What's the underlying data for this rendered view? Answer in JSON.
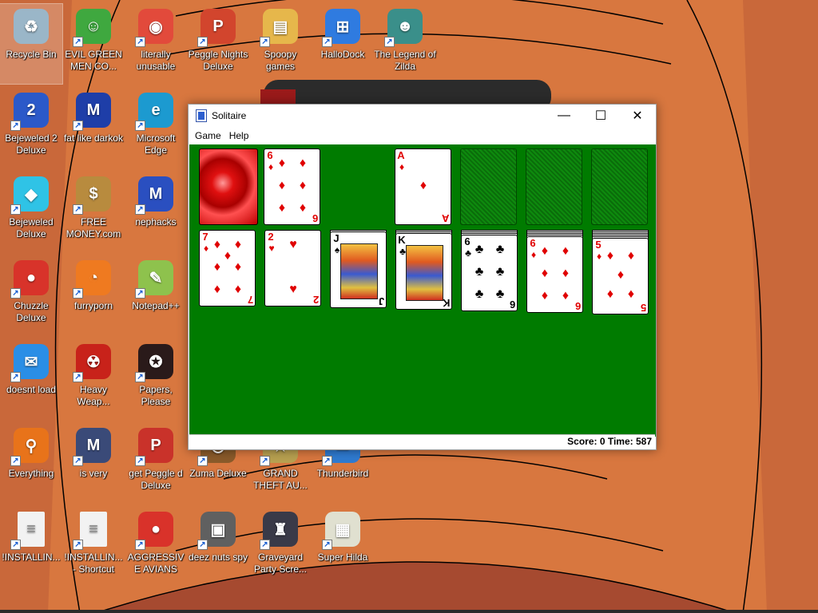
{
  "desktop": {
    "icons": [
      {
        "label": "Recycle Bin",
        "icon": "recycle-bin-icon",
        "color": "#9ab6c8",
        "glyph": "♻"
      },
      {
        "label": "EVIL GREEN MEN CO...",
        "icon": "green-men-icon",
        "color": "#3fa83f",
        "glyph": "☺"
      },
      {
        "label": "literally unusable",
        "icon": "chrome-icon",
        "color": "#e24a3b",
        "glyph": "◉"
      },
      {
        "label": "Peggle Nights Deluxe",
        "icon": "peggle-icon",
        "color": "#d2452d",
        "glyph": "P"
      },
      {
        "label": "Spoopy games",
        "icon": "folder-icon",
        "color": "#e6b74b",
        "glyph": "▤"
      },
      {
        "label": "HalloDock",
        "icon": "windows-logo-icon",
        "color": "#2f7be0",
        "glyph": "⊞"
      },
      {
        "label": "The Legend of Zilda",
        "icon": "zilda-icon",
        "color": "#3a8f8a",
        "glyph": "☻"
      },
      {
        "label": "Bejeweled 2 Deluxe",
        "icon": "bejeweled2-icon",
        "color": "#2b59c9",
        "glyph": "2"
      },
      {
        "label": "fat like darkok",
        "icon": "mpi-icon",
        "color": "#1e3ea8",
        "glyph": "M"
      },
      {
        "label": "Microsoft Edge",
        "icon": "edge-icon",
        "color": "#1c9ad0",
        "glyph": "e"
      },
      {
        "label": "Bejeweled Deluxe",
        "icon": "gem-icon",
        "color": "#2fc3e6",
        "glyph": "◆"
      },
      {
        "label": "FREE MONEY.com",
        "icon": "money-bag-icon",
        "color": "#b88b3e",
        "glyph": "$"
      },
      {
        "label": "nephacks",
        "icon": "mpi-icon",
        "color": "#2a4fc0",
        "glyph": "M"
      },
      {
        "label": "Chuzzle Deluxe",
        "icon": "chuzzle-icon",
        "color": "#d8332a",
        "glyph": "●"
      },
      {
        "label": "furryporn",
        "icon": "firefox-icon",
        "color": "#ef7a20",
        "glyph": "◔"
      },
      {
        "label": "Notepad++",
        "icon": "notepadpp-icon",
        "color": "#8ec24d",
        "glyph": "✎"
      },
      {
        "label": "doesnt load",
        "icon": "thunderbird-icon",
        "color": "#2a8ee6",
        "glyph": "✉"
      },
      {
        "label": "Heavy Weap...",
        "icon": "radiation-icon",
        "color": "#c8221a",
        "glyph": "☢"
      },
      {
        "label": "Papers, Please",
        "icon": "papers-please-icon",
        "color": "#2a1a1a",
        "glyph": "✪"
      },
      {
        "label": "Everything",
        "icon": "search-icon",
        "color": "#e8731a",
        "glyph": "⚲"
      },
      {
        "label": "is very",
        "icon": "mpi-icon",
        "color": "#3a4a78",
        "glyph": "M"
      },
      {
        "label": "get Peggle d Deluxe",
        "icon": "peggle-icon",
        "color": "#c9322a",
        "glyph": "P"
      },
      {
        "label": "Zuma Deluxe",
        "icon": "zuma-icon",
        "color": "#8a5a2a",
        "glyph": "◎"
      },
      {
        "label": "GRAND THEFT AU...",
        "icon": "gta-icon",
        "color": "#b8a050",
        "glyph": "★"
      },
      {
        "label": "Thunderbird",
        "icon": "thunderbird-icon",
        "color": "#2f7ad0",
        "glyph": "✉"
      },
      {
        "label": "!INSTALLIN...",
        "icon": "document-icon",
        "color": "#f2f2f2",
        "glyph": "≡"
      },
      {
        "label": "!INSTALLIN... - Shortcut",
        "icon": "document-icon",
        "color": "#f2f2f2",
        "glyph": "≡"
      },
      {
        "label": "AGGRESSIVE AVIANS",
        "icon": "angry-bird-icon",
        "color": "#d9322a",
        "glyph": "●"
      },
      {
        "label": "deez nuts spy",
        "icon": "stacked-windows-icon",
        "color": "#606060",
        "glyph": "▣"
      },
      {
        "label": "Graveyard Party Scre...",
        "icon": "graveyard-icon",
        "color": "#3a3a48",
        "glyph": "♜"
      },
      {
        "label": "Super Hilda",
        "icon": "hilda-icon",
        "color": "#e0e0d0",
        "glyph": "▦"
      }
    ]
  },
  "window": {
    "title": "Solitaire",
    "menu": [
      "Game",
      "Help"
    ],
    "minimize": "—",
    "maximize": "☐",
    "close": "✕",
    "status": "Score: 0 Time: 587",
    "colors": {
      "felt": "#007b00",
      "red": "#e00000",
      "black": "#000000"
    }
  },
  "cards": {
    "waste": {
      "rank": "6",
      "suit": "♦"
    },
    "foundation": {
      "rank": "A",
      "suit": "♦"
    },
    "tableau": [
      {
        "rank": "7",
        "suit": "♦"
      },
      {
        "rank": "2",
        "suit": "♥"
      },
      {
        "rank": "J",
        "suit": "♠"
      },
      {
        "rank": "K",
        "suit": "♣"
      },
      {
        "rank": "6",
        "suit": "♣"
      },
      {
        "rank": "6",
        "suit": "♦"
      },
      {
        "rank": "5",
        "suit": "♦"
      }
    ]
  }
}
